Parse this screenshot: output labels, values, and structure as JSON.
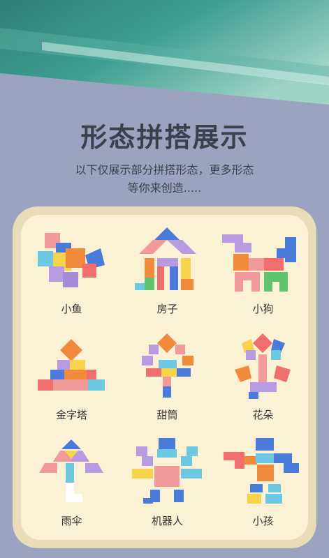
{
  "header": {
    "title": "形态拼搭展示",
    "subtitle_line1": "以下仅展示部分拼搭形态，更多形态",
    "subtitle_line2": "等你来创造....."
  },
  "shapes": [
    {
      "label": "小鱼"
    },
    {
      "label": "房子"
    },
    {
      "label": "小狗"
    },
    {
      "label": "金字塔"
    },
    {
      "label": "甜筒"
    },
    {
      "label": "花朵"
    },
    {
      "label": "雨伞"
    },
    {
      "label": "机器人"
    },
    {
      "label": "小孩"
    }
  ]
}
